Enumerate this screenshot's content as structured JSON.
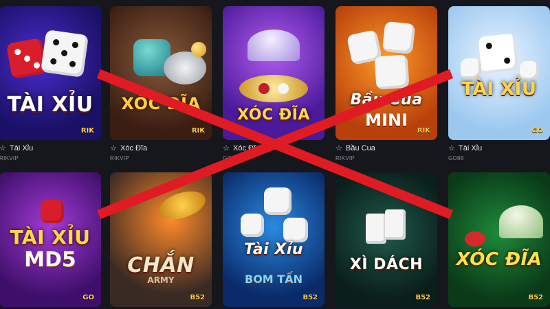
{
  "colors": {
    "background": "#15171c",
    "cross": "#e01b24",
    "title_gold": "#ffd54a"
  },
  "games": [
    {
      "name": "Tài Xỉu",
      "provider": "RIKVIP",
      "art_title": "TÀI XỈU",
      "art_sub": "",
      "badge": "RIK",
      "star_icon": "star-outline-icon"
    },
    {
      "name": "Xóc Đĩa",
      "provider": "RIKVIP",
      "art_title": "XÓC ĐĨA",
      "art_sub": "",
      "badge": "RIK",
      "star_icon": "star-outline-icon"
    },
    {
      "name": "Xóc Đĩa",
      "provider": "GO88",
      "art_title": "XÓC ĐĨA",
      "art_sub": "",
      "badge": "",
      "star_icon": "star-outline-icon"
    },
    {
      "name": "Bầu Cua",
      "provider": "RIKVIP",
      "art_title": "Bầu Cua",
      "art_sub": "MINI",
      "badge": "RIK",
      "star_icon": "star-outline-icon"
    },
    {
      "name": "Tài Xỉu",
      "provider": "GO88",
      "art_title": "TÀI XỈU",
      "art_sub": "",
      "badge": "GO",
      "star_icon": "star-outline-icon"
    },
    {
      "art_title": "TÀI XỈU",
      "art_sub": "MD5",
      "badge": "GO"
    },
    {
      "art_title": "CHẮN",
      "art_sub": "ARMY",
      "badge": "B52"
    },
    {
      "art_title": "Tài Xỉu",
      "art_sub": "BOM TẤN",
      "badge": "B52"
    },
    {
      "art_title": "XÌ DÁCH",
      "art_sub": "",
      "badge": "B52"
    },
    {
      "art_title": "XÓC ĐĨA",
      "art_sub": "",
      "badge": "B52"
    }
  ]
}
